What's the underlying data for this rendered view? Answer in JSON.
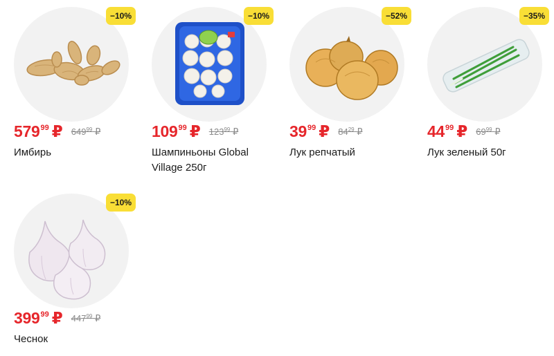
{
  "products": [
    {
      "name": "Имбирь",
      "discount": "−10%",
      "price_main": "579",
      "price_kop": "99",
      "currency": "₽",
      "old_main": "649",
      "old_kop": "99",
      "old_currency": "₽",
      "image": "ginger"
    },
    {
      "name": "Шампиньоны Global Village 250г",
      "discount": "−10%",
      "price_main": "109",
      "price_kop": "99",
      "currency": "₽",
      "old_main": "123",
      "old_kop": "99",
      "old_currency": "₽",
      "image": "mushrooms-tray"
    },
    {
      "name": "Лук репчатый",
      "discount": "−52%",
      "price_main": "39",
      "price_kop": "99",
      "currency": "₽",
      "old_main": "84",
      "old_kop": "29",
      "old_currency": "₽",
      "image": "onions"
    },
    {
      "name": "Лук зеленый 50г",
      "discount": "−35%",
      "price_main": "44",
      "price_kop": "99",
      "currency": "₽",
      "old_main": "69",
      "old_kop": "99",
      "old_currency": "₽",
      "image": "green-onion-pack"
    },
    {
      "name": "Чеснок",
      "discount": "−10%",
      "price_main": "399",
      "price_kop": "99",
      "currency": "₽",
      "old_main": "447",
      "old_kop": "99",
      "old_currency": "₽",
      "image": "garlic"
    }
  ],
  "colors": {
    "badge": "#f9de36",
    "price": "#e6262b",
    "old_price": "#8a8a8a",
    "image_bg": "#f2f2f2"
  }
}
